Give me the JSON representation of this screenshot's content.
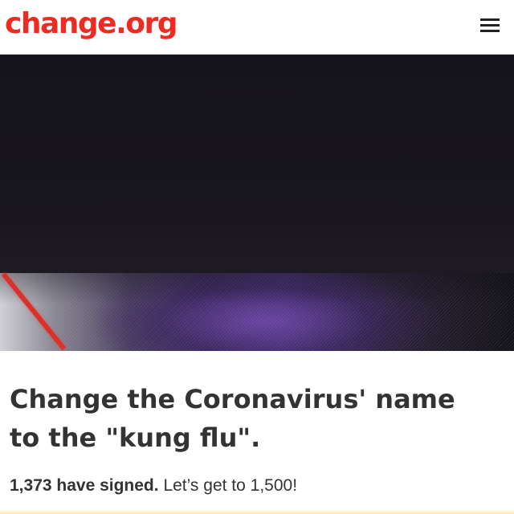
{
  "header": {
    "logo": "change.org",
    "menu_icon": "hamburger-menu-icon"
  },
  "hero": {
    "image": "dark stage with purple-lit floor and red light streak"
  },
  "petition": {
    "title": "Change the Coronavirus' name to the \"kung flu\".",
    "signed_count": "1,373 have signed.",
    "goal_text": "Let’s get to 1,500!"
  },
  "colors": {
    "brand": "#ec2c22",
    "text": "#333333",
    "header_border": "#d9d9d9"
  }
}
